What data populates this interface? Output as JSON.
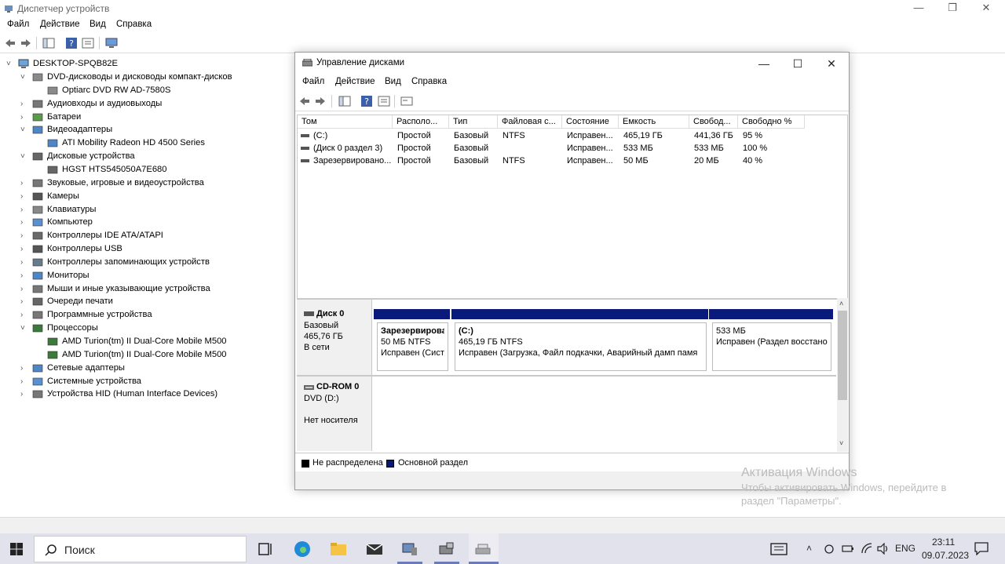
{
  "device_manager": {
    "title": "Диспетчер устройств",
    "window_controls": {
      "minimize": "—",
      "maximize": "❐",
      "close": "✕"
    },
    "menu": [
      "Файл",
      "Действие",
      "Вид",
      "Справка"
    ],
    "tree": {
      "root": "DESKTOP-SPQB82E",
      "rows": [
        {
          "label": "DVD-дисководы и дисководы компакт-дисков",
          "expander": "˅",
          "icon": "dvd-drive-icon"
        },
        {
          "label": "Optiarc DVD RW AD-7580S",
          "expander": "",
          "icon": "dvd-drive-icon"
        },
        {
          "label": "Аудиовходы и аудиовыходы",
          "expander": "›",
          "icon": "speaker-icon"
        },
        {
          "label": "Батареи",
          "expander": "›",
          "icon": "battery-icon"
        },
        {
          "label": "Видеоадаптеры",
          "expander": "˅",
          "icon": "display-adapter-icon"
        },
        {
          "label": "ATI Mobility Radeon HD 4500 Series",
          "expander": "",
          "icon": "display-adapter-icon"
        },
        {
          "label": "Дисковые устройства",
          "expander": "˅",
          "icon": "disk-drive-icon"
        },
        {
          "label": "HGST HTS545050A7E680",
          "expander": "",
          "icon": "disk-drive-icon"
        },
        {
          "label": "Звуковые, игровые и видеоустройства",
          "expander": "›",
          "icon": "sound-icon"
        },
        {
          "label": "Камеры",
          "expander": "›",
          "icon": "camera-icon"
        },
        {
          "label": "Клавиатуры",
          "expander": "›",
          "icon": "keyboard-icon"
        },
        {
          "label": "Компьютер",
          "expander": "›",
          "icon": "computer-icon"
        },
        {
          "label": "Контроллеры IDE ATA/ATAPI",
          "expander": "›",
          "icon": "ide-controller-icon"
        },
        {
          "label": "Контроллеры USB",
          "expander": "›",
          "icon": "usb-icon"
        },
        {
          "label": "Контроллеры запоминающих устройств",
          "expander": "›",
          "icon": "storage-controller-icon"
        },
        {
          "label": "Мониторы",
          "expander": "›",
          "icon": "monitor-icon"
        },
        {
          "label": "Мыши и иные указывающие устройства",
          "expander": "›",
          "icon": "mouse-icon"
        },
        {
          "label": "Очереди печати",
          "expander": "›",
          "icon": "printer-icon"
        },
        {
          "label": "Программные устройства",
          "expander": "›",
          "icon": "software-device-icon"
        },
        {
          "label": "Процессоры",
          "expander": "˅",
          "icon": "processor-icon"
        },
        {
          "label": "AMD Turion(tm) II Dual-Core Mobile M500",
          "expander": "",
          "icon": "processor-icon"
        },
        {
          "label": "AMD Turion(tm) II Dual-Core Mobile M500",
          "expander": "",
          "icon": "processor-icon"
        },
        {
          "label": "Сетевые адаптеры",
          "expander": "›",
          "icon": "network-adapter-icon"
        },
        {
          "label": "Системные устройства",
          "expander": "›",
          "icon": "system-device-icon"
        },
        {
          "label": "Устройства HID (Human Interface Devices)",
          "expander": "›",
          "icon": "hid-icon"
        }
      ]
    }
  },
  "disk_management": {
    "title": "Управление дисками",
    "window_controls": {
      "minimize": "—",
      "maximize": "☐",
      "close": "✕"
    },
    "menu": [
      "Файл",
      "Действие",
      "Вид",
      "Справка"
    ],
    "columns": [
      "Том",
      "Располо...",
      "Тип",
      "Файловая с...",
      "Состояние",
      "Емкость",
      "Свобод...",
      "Свободно %"
    ],
    "volumes": [
      [
        "(C:)",
        "Простой",
        "Базовый",
        "NTFS",
        "Исправен...",
        "465,19 ГБ",
        "441,36 ГБ",
        "95 %"
      ],
      [
        "(Диск 0 раздел 3)",
        "Простой",
        "Базовый",
        "",
        "Исправен...",
        "533 МБ",
        "533 МБ",
        "100 %"
      ],
      [
        "Зарезервировано...",
        "Простой",
        "Базовый",
        "NTFS",
        "Исправен...",
        "50 МБ",
        "20 МБ",
        "40 %"
      ]
    ],
    "disks": [
      {
        "name": "Диск 0",
        "type": "Базовый",
        "size": "465,76 ГБ",
        "status": "В сети",
        "partitions": [
          {
            "name": "Зарезервирова",
            "size": "50 МБ NTFS",
            "status": "Исправен (Систе"
          },
          {
            "name": "(C:)",
            "size": "465,19 ГБ NTFS",
            "status": "Исправен (Загрузка, Файл подкачки, Аварийный дамп памя"
          },
          {
            "name": "",
            "size": "533 МБ",
            "status": "Исправен (Раздел восстанов"
          }
        ]
      },
      {
        "name": "CD-ROM 0",
        "type": "DVD (D:)",
        "size": "",
        "status": "Нет носителя",
        "partitions": []
      }
    ],
    "legend": [
      {
        "label": "Не распределена",
        "color": "#000000"
      },
      {
        "label": "Основной раздел",
        "color": "#0a1a7a"
      }
    ]
  },
  "watermark": {
    "line1": "Активация Windows",
    "line2": "Чтобы активировать Windows, перейдите в",
    "line3": "раздел \"Параметры\"."
  },
  "taskbar": {
    "search_label": "Поиск",
    "language": "ENG",
    "time": "23:11",
    "date": "09.07.2023"
  }
}
